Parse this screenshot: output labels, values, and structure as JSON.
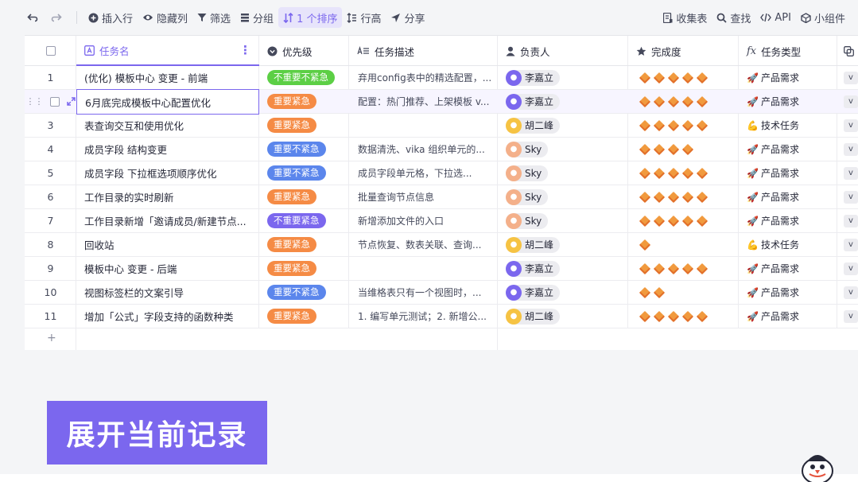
{
  "toolbar": {
    "undo": "undo-icon",
    "redo": "redo-icon",
    "insert_row": "插入行",
    "hide_cols": "隐藏列",
    "filter": "筛选",
    "group": "分组",
    "sort": "1 个排序",
    "row_height": "行高",
    "share": "分享",
    "form": "收集表",
    "search": "查找",
    "api": "API",
    "widget": "小组件"
  },
  "columns": {
    "name": "任务名",
    "priority": "优先级",
    "desc": "任务描述",
    "owner": "负责人",
    "progress": "完成度",
    "type": "任务类型"
  },
  "rows": [
    {
      "idx": "1",
      "name": "(优化) 模板中心 变更 - 前端",
      "priority": "不重要不紧急",
      "desc": "弃用config表中的精选配置，...",
      "owner": "李嘉立",
      "stars": 5,
      "type": "产品需求",
      "type_icon": "rocket"
    },
    {
      "idx": "",
      "name": "6月底完成模板中心配置优化",
      "priority": "重要紧急",
      "desc": "配置：热门推荐、上架模板 v...",
      "owner": "李嘉立",
      "stars": 5,
      "type": "产品需求",
      "type_icon": "rocket"
    },
    {
      "idx": "3",
      "name": "表查询交互和使用优化",
      "priority": "重要紧急",
      "desc": "",
      "owner": "胡二峰",
      "stars": 5,
      "type": "技术任务",
      "type_icon": "muscle"
    },
    {
      "idx": "4",
      "name": "成员字段 结构变更",
      "priority": "重要不紧急",
      "desc": "数据清洗、vika 组织单元的...",
      "owner": "Sky",
      "stars": 4,
      "type": "产品需求",
      "type_icon": "rocket"
    },
    {
      "idx": "5",
      "name": "成员字段 下拉框选项顺序优化",
      "priority": "重要不紧急",
      "desc": "成员字段单元格，下拉选...",
      "owner": "Sky",
      "stars": 5,
      "type": "产品需求",
      "type_icon": "rocket"
    },
    {
      "idx": "6",
      "name": "工作目录的实时刷新",
      "priority": "重要紧急",
      "desc": "批量查询节点信息",
      "owner": "Sky",
      "stars": 5,
      "type": "产品需求",
      "type_icon": "rocket"
    },
    {
      "idx": "7",
      "name": "工作目录新增「邀请成员/新建节点...",
      "priority": "不重要紧急",
      "desc": "新增添加文件的入口",
      "owner": "Sky",
      "stars": 5,
      "type": "产品需求",
      "type_icon": "rocket"
    },
    {
      "idx": "8",
      "name": "回收站",
      "priority": "重要紧急",
      "desc": "节点恢复、数表关联、查询...",
      "owner": "胡二峰",
      "stars": 1,
      "type": "技术任务",
      "type_icon": "muscle"
    },
    {
      "idx": "9",
      "name": "模板中心 变更 - 后端",
      "priority": "重要紧急",
      "desc": "",
      "owner": "李嘉立",
      "stars": 5,
      "type": "产品需求",
      "type_icon": "rocket"
    },
    {
      "idx": "10",
      "name": "视图标签栏的文案引导",
      "priority": "重要不紧急",
      "desc": "当维格表只有一个视图时，...",
      "owner": "李嘉立",
      "stars": 2,
      "type": "产品需求",
      "type_icon": "rocket"
    },
    {
      "idx": "11",
      "name": "增加「公式」字段支持的函数种类",
      "priority": "重要紧急",
      "desc": "1. 编写单元测试；2. 新增公...",
      "owner": "胡二峰",
      "stars": 5,
      "type": "产品需求",
      "type_icon": "rocket"
    }
  ],
  "priority_colors": {
    "不重要不紧急": "#5ccf45",
    "重要紧急": "#f58b45",
    "重要不紧急": "#5b86ec",
    "不重要紧急": "#7b67ee"
  },
  "owner_colors": {
    "李嘉立": "#7b67ee",
    "胡二峰": "#f6c343",
    "Sky": "#f4b08a"
  },
  "chip_text": "v",
  "add_row": "+",
  "banner": "展开当前记录"
}
